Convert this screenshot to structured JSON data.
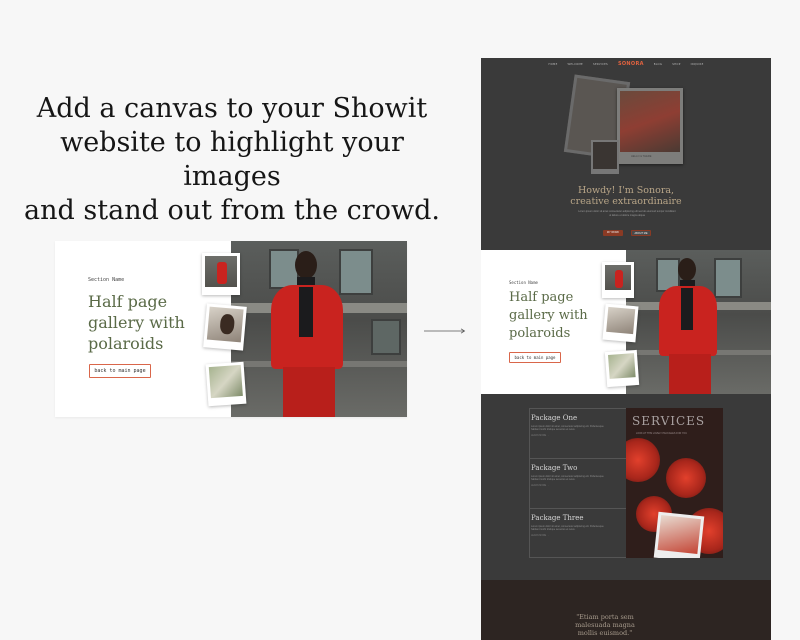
{
  "headline": {
    "line1": "Add a canvas to your Showit",
    "line2": "website to highlight your images",
    "line3": "and stand out from the crowd."
  },
  "section_card": {
    "label": "Section Name",
    "title_line1": "Half page",
    "title_line2": "gallery with",
    "title_line3": "polaroids",
    "button_label": "back to main page"
  },
  "site_preview": {
    "nav": {
      "items_left": [
        "HOME",
        "WELCOME",
        "SERVICES"
      ],
      "logo": "SONORA",
      "items_right": [
        "BLOG",
        "SHOP",
        "INQUIRE"
      ]
    },
    "polaroid_caption": "HELLO & THERE",
    "howdy_line1": "Howdy! I'm Sonora,",
    "howdy_line2": "creative extraordinaire",
    "intro_text": "Lorem ipsum dolor sit amet consectetur adipiscing elit sed do eiusmod tempor incididunt ut labore et dolore magna aliqua",
    "btn_primary": "MY WORK",
    "btn_secondary": "ABOUT ME",
    "mid_section": {
      "label": "Section Name",
      "title_line1": "Half page",
      "title_line2": "gallery with",
      "title_line3": "polaroids",
      "button_label": "back to main page"
    },
    "packages": [
      {
        "name": "Package One",
        "desc": "Lorem ipsum dolor sit amet, consectetur adipiscing elit. Pellentesque habitant morbi tristique senectus et netus.",
        "more": "LEARN MORE →"
      },
      {
        "name": "Package Two",
        "desc": "Lorem ipsum dolor sit amet, consectetur adipiscing elit. Pellentesque habitant morbi tristique senectus et netus.",
        "more": "LEARN MORE →"
      },
      {
        "name": "Package Three",
        "desc": "Lorem ipsum dolor sit amet, consectetur adipiscing elit. Pellentesque habitant morbi tristique senectus et netus.",
        "more": "LEARN MORE →"
      }
    ],
    "services_title": "SERVICES",
    "services_sub": "LOOK AT THIS LOVELY PACKAGES FOR YOU",
    "quote": "\"Etiam porta sem malesuada magna mollis euismod.\""
  },
  "colors": {
    "accent": "#d9664a",
    "title_green": "#5a6a47",
    "jacket_red": "#c9231f"
  }
}
